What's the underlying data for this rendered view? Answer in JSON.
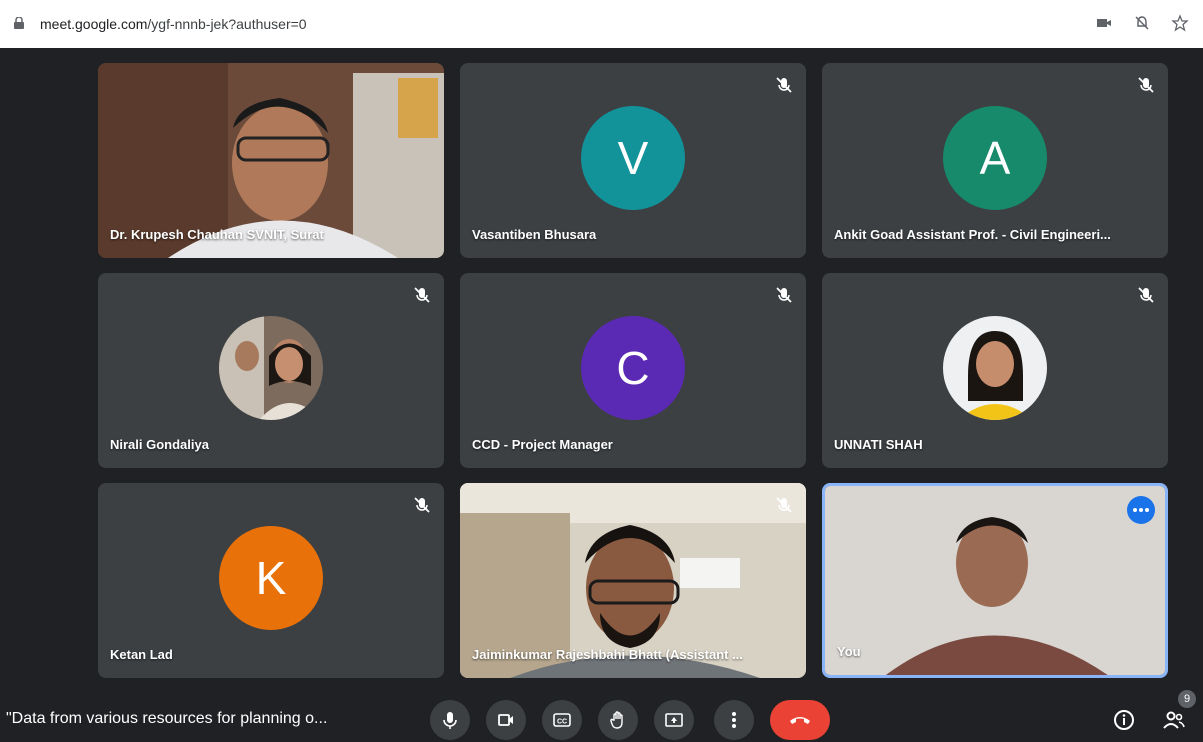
{
  "browser": {
    "url_host": "meet.google.com",
    "url_path": "/ygf-nnnb-jek?authuser=0"
  },
  "tiles": [
    {
      "name": "Dr. Krupesh Chauhan SVNIT, Surat",
      "type": "video"
    },
    {
      "name": "Vasantiben Bhusara",
      "type": "avatar",
      "initial": "V",
      "color": "#12939a"
    },
    {
      "name": "Ankit Goad Assistant Prof. - Civil Engineeri...",
      "type": "avatar",
      "initial": "A",
      "color": "#168a6b"
    },
    {
      "name": "Nirali Gondaliya",
      "type": "photo"
    },
    {
      "name": "CCD - Project Manager",
      "type": "avatar",
      "initial": "C",
      "color": "#5b2ab5"
    },
    {
      "name": "UNNATI SHAH",
      "type": "photo"
    },
    {
      "name": "Ketan Lad",
      "type": "avatar",
      "initial": "K",
      "color": "#e8710a"
    },
    {
      "name": "Jaiminkumar Rajeshbahi Bhatt (Assistant ...",
      "type": "video"
    },
    {
      "name": "You",
      "type": "video"
    }
  ],
  "meeting": {
    "title": "\"Data from various resources for planning o...",
    "participant_count": "9"
  },
  "icons": {
    "mic": "mic-icon",
    "camera": "camera-icon",
    "captions": "captions-icon",
    "hand": "raise-hand-icon",
    "present": "present-icon",
    "more": "more-vert-icon",
    "end": "end-call-icon",
    "info": "info-icon",
    "people": "people-icon"
  }
}
